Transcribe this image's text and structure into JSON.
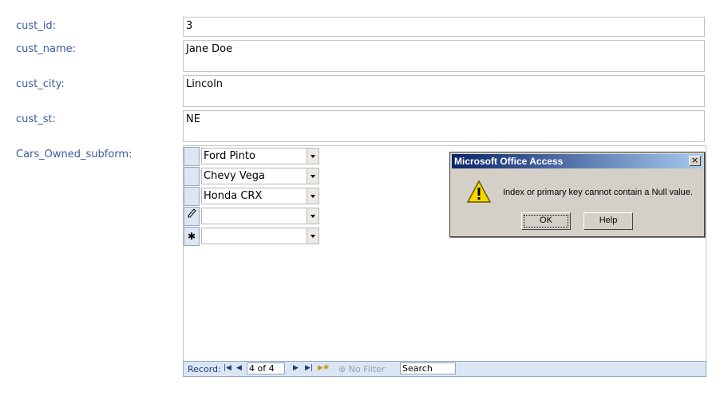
{
  "form": {
    "labels": {
      "cust_id": "cust_id:",
      "cust_name": "cust_name:",
      "cust_city": "cust_city:",
      "cust_st": "cust_st:",
      "subform": "Cars_Owned_subform:"
    },
    "values": {
      "cust_id": "3",
      "cust_name": "Jane Doe",
      "cust_city": "Lincoln",
      "cust_st": "NE"
    }
  },
  "subform": {
    "rows": [
      {
        "selector": "",
        "value": "Ford Pinto"
      },
      {
        "selector": "",
        "value": "Chevy Vega"
      },
      {
        "selector": "",
        "value": "Honda CRX"
      },
      {
        "selector": "pencil-icon",
        "value": ""
      },
      {
        "selector": "new-record-icon",
        "value": ""
      }
    ]
  },
  "navbar": {
    "record_label": "Record:",
    "record_value": "4 of 4",
    "no_filter": "No Filter",
    "search": "Search"
  },
  "dialog": {
    "title": "Microsoft Office Access",
    "message": "Index or primary key cannot contain a Null value.",
    "ok": "OK",
    "help": "Help",
    "close": "×"
  }
}
